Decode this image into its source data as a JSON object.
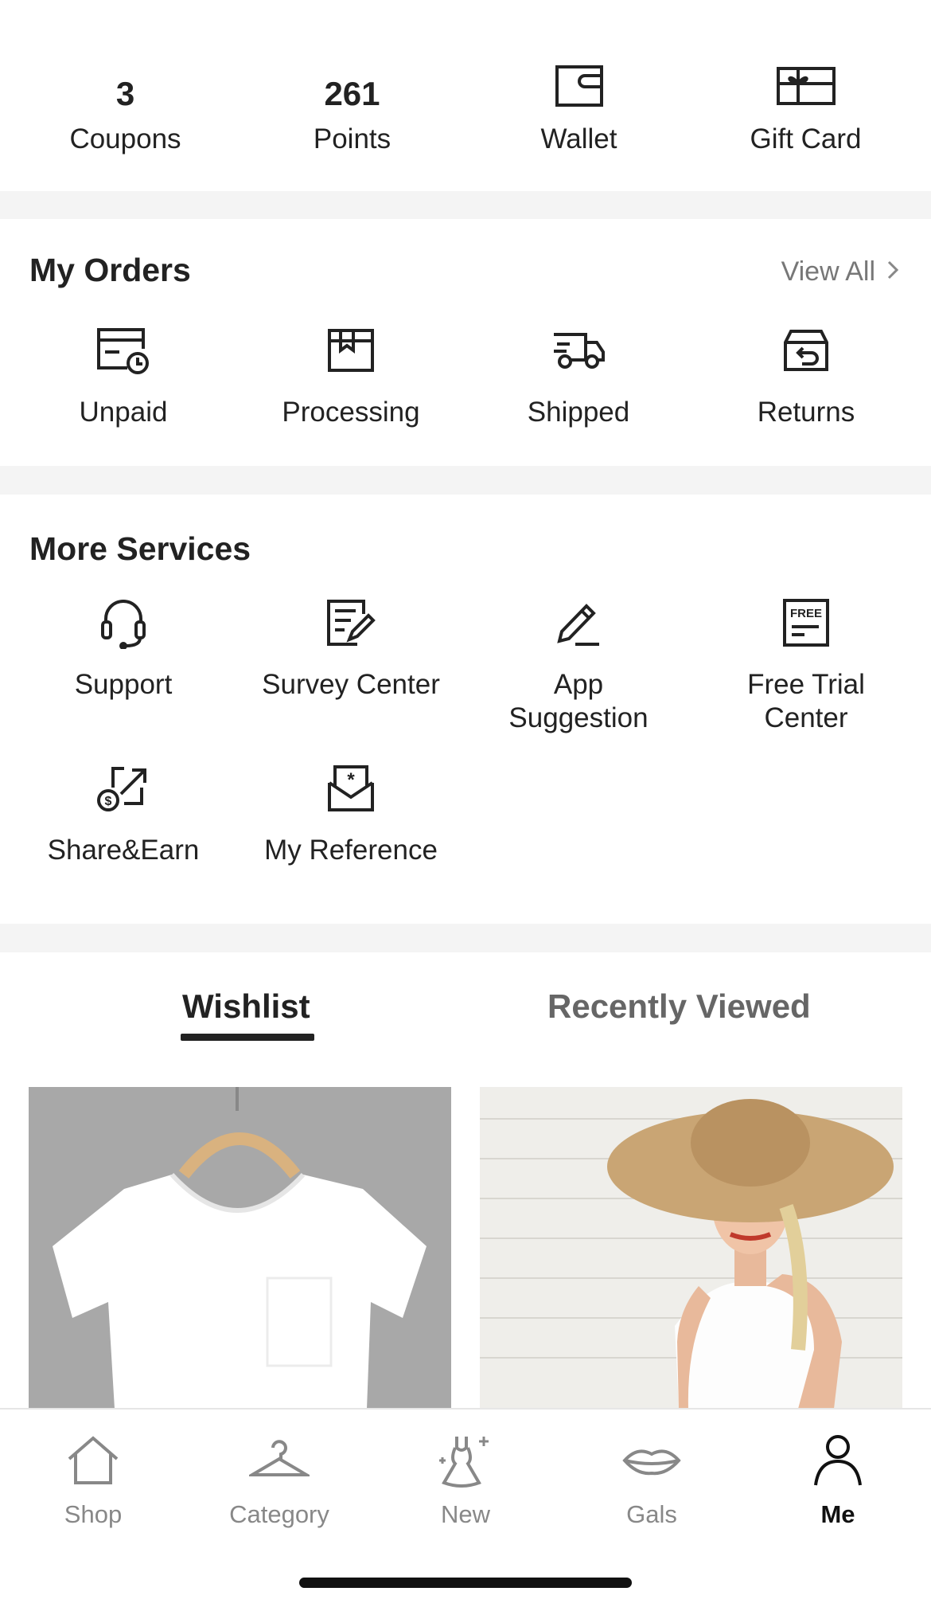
{
  "stats": [
    {
      "value": "3",
      "label": "Coupons"
    },
    {
      "value": "261",
      "label": "Points"
    },
    {
      "icon": "wallet-icon",
      "label": "Wallet"
    },
    {
      "icon": "gift-card-icon",
      "label": "Gift Card"
    }
  ],
  "orders": {
    "title": "My Orders",
    "view_all": "View All",
    "items": [
      {
        "icon": "unpaid-icon",
        "label": "Unpaid"
      },
      {
        "icon": "processing-icon",
        "label": "Processing"
      },
      {
        "icon": "truck-icon",
        "label": "Shipped"
      },
      {
        "icon": "returns-icon",
        "label": "Returns"
      }
    ]
  },
  "services": {
    "title": "More Services",
    "items": [
      {
        "icon": "headset-icon",
        "label": "Support"
      },
      {
        "icon": "survey-icon",
        "label": "Survey Center"
      },
      {
        "icon": "pencil-icon",
        "label_line1": "App",
        "label_line2": "Suggestion"
      },
      {
        "icon": "free-trial-icon",
        "label_line1": "Free Trial",
        "label_line2": "Center"
      },
      {
        "icon": "share-earn-icon",
        "label": "Share&Earn"
      },
      {
        "icon": "reference-icon",
        "label": "My Reference"
      }
    ]
  },
  "tabs": {
    "wishlist": "Wishlist",
    "recently_viewed": "Recently Viewed",
    "active": "wishlist"
  },
  "products": [
    {
      "image": "white-tshirt-on-hanger"
    },
    {
      "image": "woman-in-straw-hat-white-tank-top"
    }
  ],
  "bottom_nav": [
    {
      "icon": "house-icon",
      "label": "Shop",
      "active": false
    },
    {
      "icon": "hanger-icon",
      "label": "Category",
      "active": false
    },
    {
      "icon": "dress-sparkle-icon",
      "label": "New",
      "active": false
    },
    {
      "icon": "lips-icon",
      "label": "Gals",
      "active": false
    },
    {
      "icon": "person-icon",
      "label": "Me",
      "active": true
    }
  ],
  "colors": {
    "text": "#222222",
    "muted": "#888888",
    "divider": "#f4f4f4",
    "active": "#111111"
  }
}
